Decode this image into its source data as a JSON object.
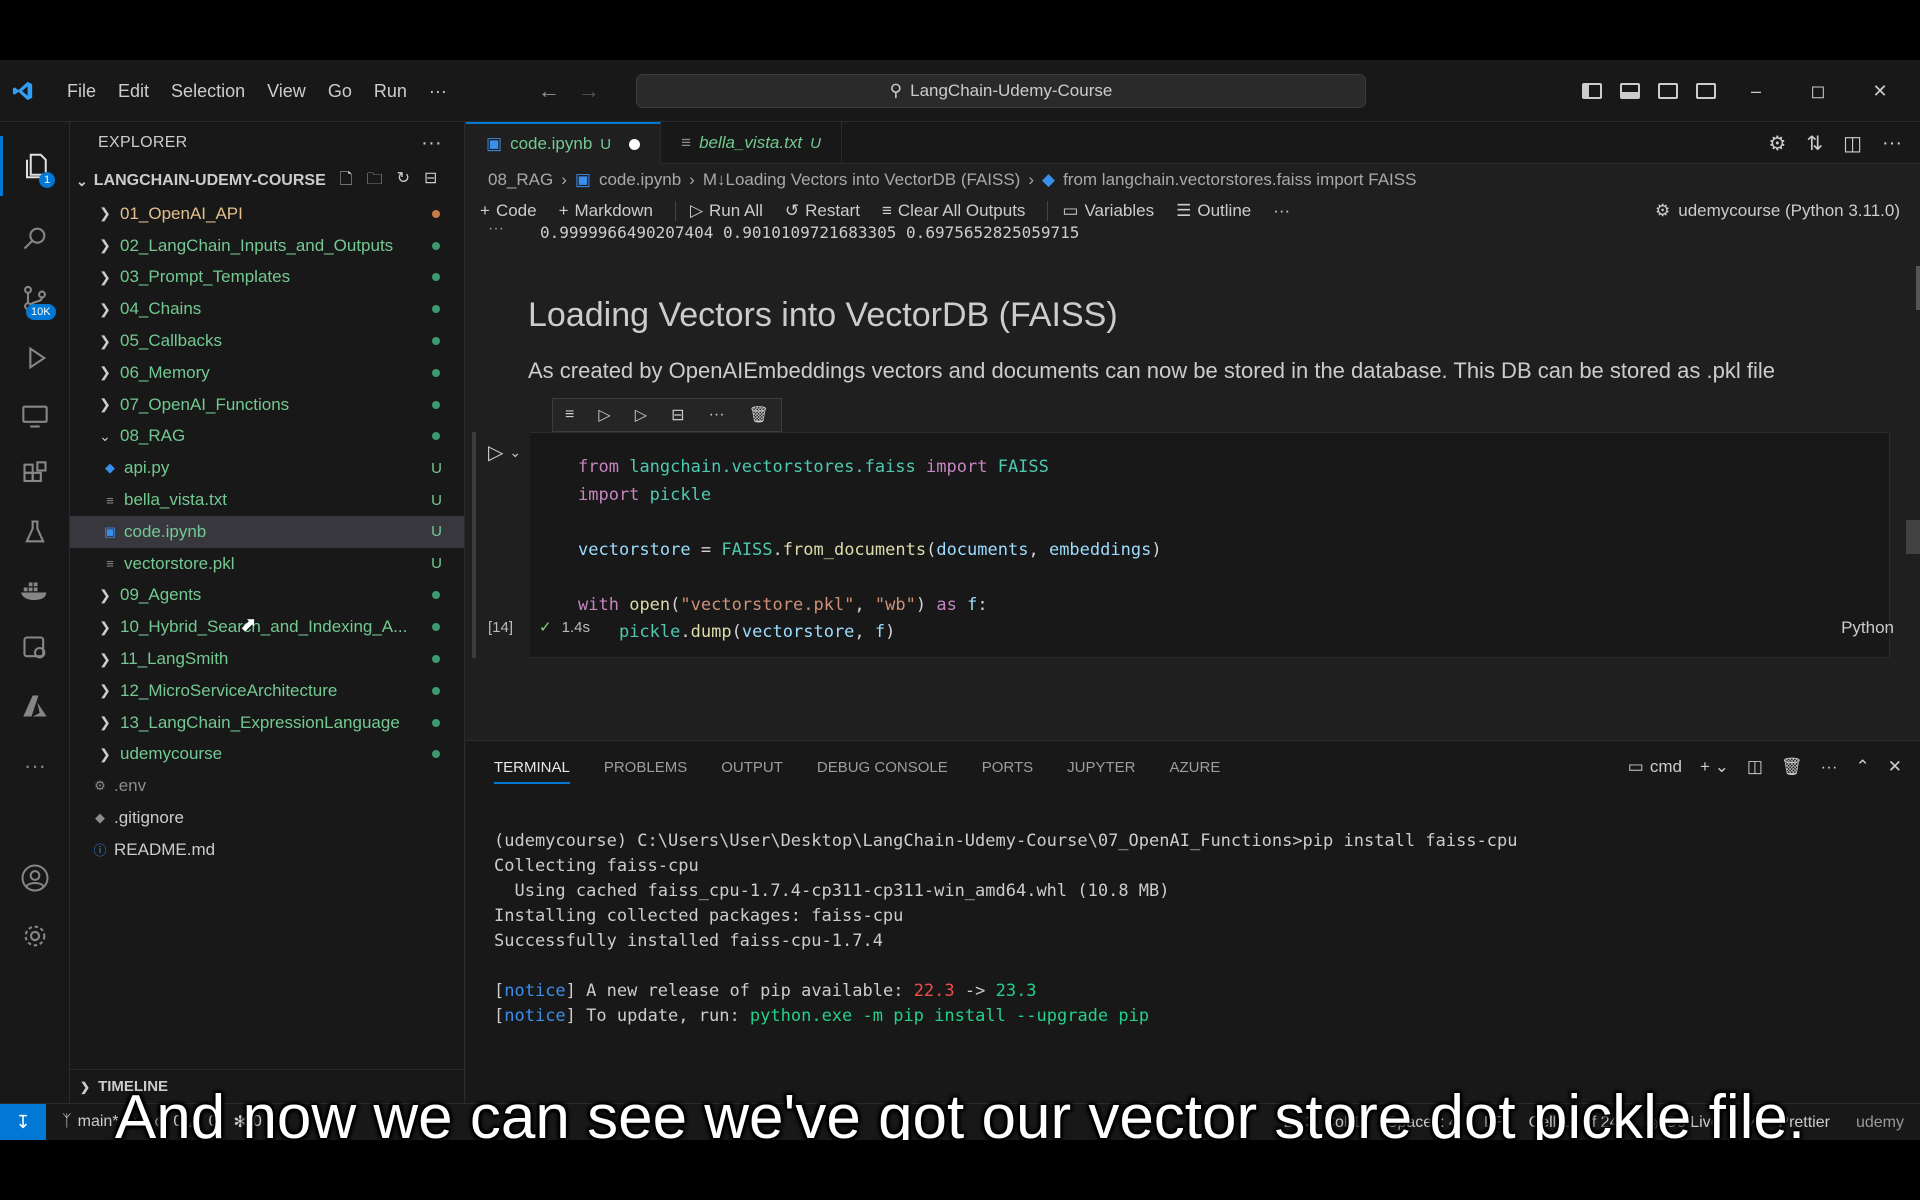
{
  "title_bar": {
    "menu": [
      "File",
      "Edit",
      "Selection",
      "View",
      "Go",
      "Run",
      "···"
    ],
    "search_text": "LangChain-Udemy-Course"
  },
  "activity_bar": {
    "explorer_badge": "1",
    "source_control_badge": "10K"
  },
  "sidebar": {
    "header": "EXPLORER",
    "root": "LANGCHAIN-UDEMY-COURSE",
    "items": [
      {
        "label": "01_OpenAI_API"
      },
      {
        "label": "02_LangChain_Inputs_and_Outputs"
      },
      {
        "label": "03_Prompt_Templates"
      },
      {
        "label": "04_Chains"
      },
      {
        "label": "05_Callbacks"
      },
      {
        "label": "06_Memory"
      },
      {
        "label": "07_OpenAI_Functions"
      },
      {
        "label": "08_RAG"
      },
      {
        "label": "api.py",
        "status": "U"
      },
      {
        "label": "bella_vista.txt",
        "status": "U"
      },
      {
        "label": "code.ipynb",
        "status": "U"
      },
      {
        "label": "vectorstore.pkl",
        "status": "U"
      },
      {
        "label": "09_Agents"
      },
      {
        "label": "10_Hybrid_Search_and_Indexing_A..."
      },
      {
        "label": "11_LangSmith"
      },
      {
        "label": "12_MicroServiceArchitecture"
      },
      {
        "label": "13_LangChain_ExpressionLanguage"
      },
      {
        "label": "udemycourse"
      },
      {
        "label": ".env"
      },
      {
        "label": ".gitignore"
      },
      {
        "label": "README.md"
      }
    ],
    "timeline": "TIMELINE"
  },
  "editor": {
    "tabs": [
      {
        "name": "code.ipynb",
        "status": "U"
      },
      {
        "name": "bella_vista.txt",
        "status": "U"
      }
    ],
    "breadcrumb": [
      "08_RAG",
      "code.ipynb",
      "M↓Loading Vectors into VectorDB (FAISS)",
      "from langchain.vectorstores.faiss import FAISS"
    ],
    "toolbar": {
      "code": "Code",
      "markdown": "Markdown",
      "run_all": "Run All",
      "restart": "Restart",
      "clear": "Clear All Outputs",
      "variables": "Variables",
      "outline": "Outline",
      "kernel": "udemycourse (Python 3.11.0)"
    },
    "prev_output": "0.9999966490207404 0.9010109721683305 0.6975652825059715",
    "markdown_heading": "Loading Vectors into VectorDB (FAISS)",
    "markdown_text": "As created by OpenAIEmbeddings vectors and documents can now be stored in the database. This DB can be stored as .pkl file",
    "cell": {
      "exec_count": "[14]",
      "time": "1.4s",
      "language": "Python"
    }
  },
  "panel": {
    "tabs": [
      "TERMINAL",
      "PROBLEMS",
      "OUTPUT",
      "DEBUG CONSOLE",
      "PORTS",
      "JUPYTER",
      "AZURE"
    ],
    "shell": "cmd",
    "terminal_lines": {
      "l1": "(udemycourse) C:\\Users\\User\\Desktop\\LangChain-Udemy-Course\\07_OpenAI_Functions>pip install faiss-cpu",
      "l2": "Collecting faiss-cpu",
      "l3": "  Using cached faiss_cpu-1.7.4-cp311-cp311-win_amd64.whl (10.8 MB)",
      "l4": "Installing collected packages: faiss-cpu",
      "l5": "Successfully installed faiss-cpu-1.7.4",
      "notice": "notice",
      "n1_text": " A new release of pip available: ",
      "n1_old": "22.3",
      "n1_arrow": " -> ",
      "n1_new": "23.3",
      "n2_text": " To update, run: ",
      "n2_cmd": "python.exe -m pip install --upgrade pip"
    }
  },
  "status_bar": {
    "branch": "main*",
    "errors": "0",
    "warnings": "0",
    "ports": "0",
    "position": "Ln 3, Col 1",
    "spaces": "Spaces: 4",
    "eol": "LF",
    "cell": "Cell 16 of 24",
    "go_live": "Go Live",
    "prettier": "Prettier",
    "brand": "udemy"
  },
  "caption": "And now we can see we've got our vector store dot pickle file."
}
